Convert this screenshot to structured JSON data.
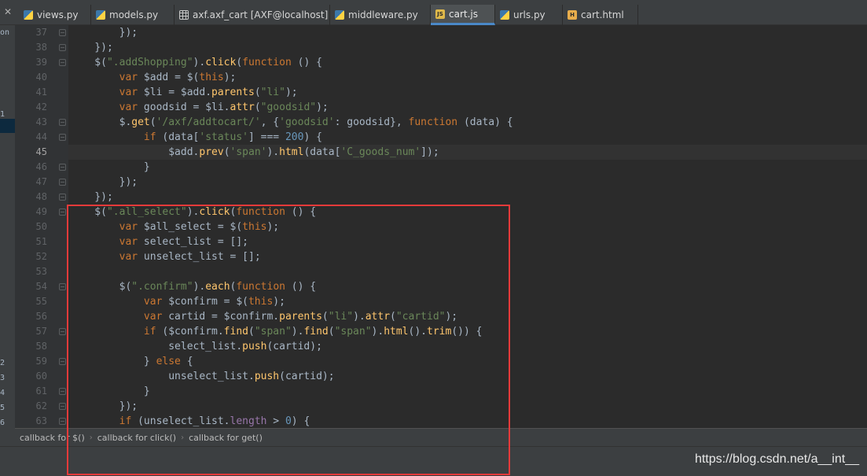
{
  "tabs": [
    {
      "label": "views.py",
      "icon": "python-file-icon",
      "active": false
    },
    {
      "label": "models.py",
      "icon": "python-file-icon",
      "active": false
    },
    {
      "label": "axf.axf_cart [AXF@localhost]",
      "icon": "table-icon",
      "active": false
    },
    {
      "label": "middleware.py",
      "icon": "python-file-icon",
      "active": false
    },
    {
      "label": "cart.js",
      "icon": "javascript-file-icon",
      "active": true
    },
    {
      "label": "urls.py",
      "icon": "python-file-icon",
      "active": false
    },
    {
      "label": "cart.html",
      "icon": "html-file-icon",
      "active": false
    }
  ],
  "left_strip_stubs": [
    "on",
    "1",
    "2",
    "3",
    "4",
    "5",
    "6"
  ],
  "line_numbers": [
    "37",
    "38",
    "39",
    "40",
    "41",
    "42",
    "43",
    "44",
    "45",
    "46",
    "47",
    "48",
    "49",
    "50",
    "51",
    "52",
    "53",
    "54",
    "55",
    "56",
    "57",
    "58",
    "59",
    "60",
    "61",
    "62",
    "63"
  ],
  "current_line": "45",
  "code_lines": [
    "        });",
    "    });",
    "    $(\".addShopping\").click(function () {",
    "        var $add = $(this);",
    "        var $li = $add.parents(\"li\");",
    "        var goodsid = $li.attr(\"goodsid\");",
    "        $.get('/axf/addtocart/', {'goodsid': goodsid}, function (data) {",
    "            if (data['status'] === 200) {",
    "                $add.prev('span').html(data['C_goods_num']);",
    "            }",
    "        });",
    "    });",
    "    $(\".all_select\").click(function () {",
    "        var $all_select = $(this);",
    "        var select_list = [];",
    "        var unselect_list = [];",
    "",
    "        $(\".confirm\").each(function () {",
    "            var $confirm = $(this);",
    "            var cartid = $confirm.parents(\"li\").attr(\"cartid\");",
    "            if ($confirm.find(\"span\").find(\"span\").html().trim()) {",
    "                select_list.push(cartid);",
    "            } else {",
    "                unselect_list.push(cartid);",
    "            }",
    "        });",
    "        if (unselect_list.length > 0) {"
  ],
  "breadcrumb": [
    "callback for $()",
    "callback for click()",
    "callback for get()"
  ],
  "watermark": "https://blog.csdn.net/a__int__",
  "colors": {
    "keyword": "#cc7832",
    "string": "#6a8759",
    "number": "#6897bb",
    "function": "#ffc66d",
    "property": "#9876aa",
    "default_text": "#a9b7c6",
    "annotation_box": "#e63a3a",
    "active_tab_underline": "#4a88c7"
  }
}
